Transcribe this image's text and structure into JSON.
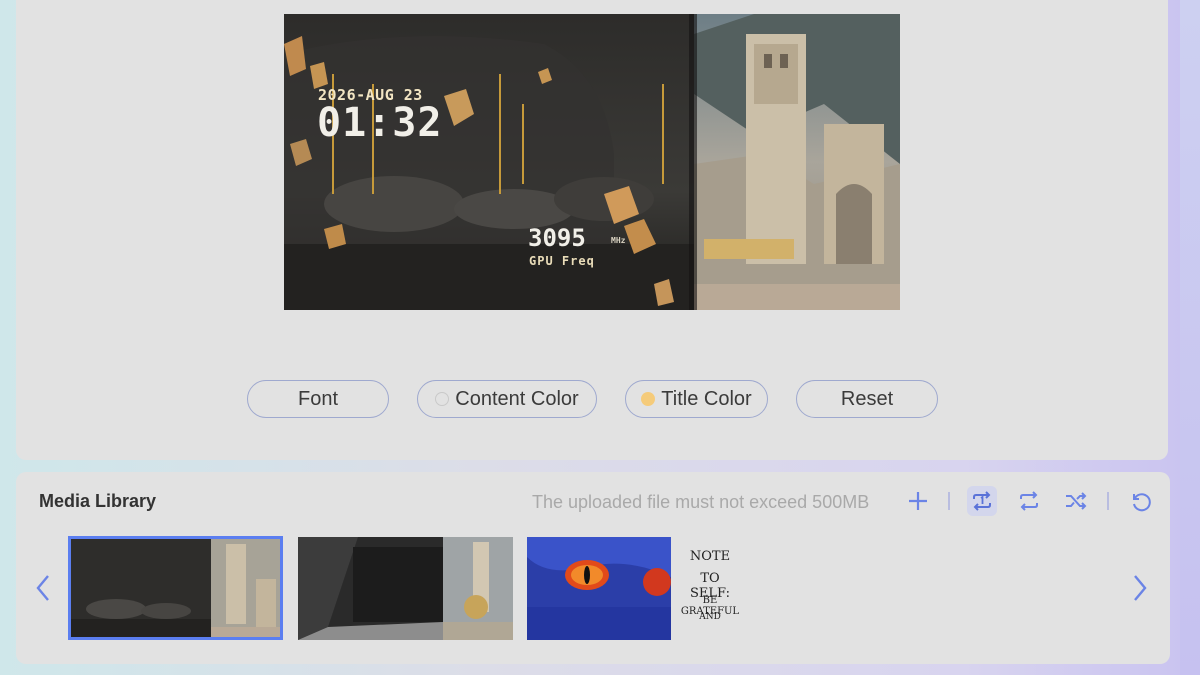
{
  "toolbar_buttons": {
    "font": "Font",
    "content_color": "Content Color",
    "title_color": "Title Color",
    "reset": "Reset"
  },
  "colors": {
    "title_color_swatch": "#f5cb7a",
    "content_color_swatch": "#e2e2e2",
    "accent": "#5b7ef0",
    "icon": "#6b84e6"
  },
  "preview": {
    "date": "2026-AUG 23",
    "time": "01:32",
    "frequency": "3095",
    "frequency_unit": "MHz",
    "frequency_label": "GPU Freq"
  },
  "library": {
    "title": "Media Library",
    "note": "The uploaded file must not exceed 500MB",
    "icons": [
      "plus-icon",
      "repeat-one-icon",
      "repeat-icon",
      "shuffle-icon",
      "undo-icon"
    ],
    "thumbnail_4_lines": [
      "NOTE",
      "TO SELF:",
      "BE GRATEFUL",
      "AND"
    ]
  }
}
